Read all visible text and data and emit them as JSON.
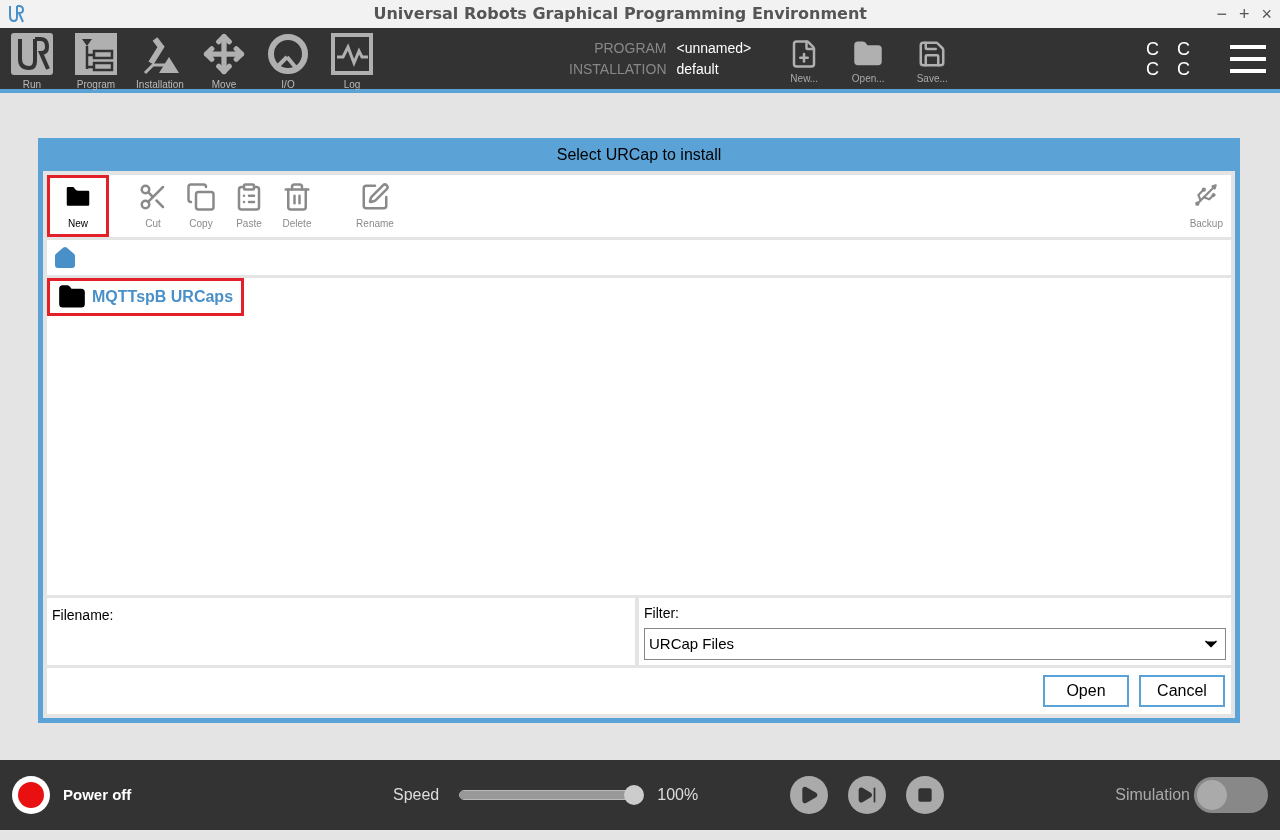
{
  "window": {
    "title": "Universal Robots Graphical Programming Environment",
    "controls": [
      "−",
      "+",
      "×"
    ]
  },
  "nav": [
    {
      "label": "Run",
      "kind": "run"
    },
    {
      "label": "Program",
      "kind": "program"
    },
    {
      "label": "Installation",
      "kind": "installation"
    },
    {
      "label": "Move",
      "kind": "move"
    },
    {
      "label": "I/O",
      "kind": "io"
    },
    {
      "label": "Log",
      "kind": "log"
    }
  ],
  "program_info": [
    {
      "label": "PROGRAM",
      "value": "<unnamed>"
    },
    {
      "label": "INSTALLATION",
      "value": "default"
    }
  ],
  "file_actions": [
    {
      "label": "New...",
      "kind": "new"
    },
    {
      "label": "Open...",
      "kind": "open"
    },
    {
      "label": "Save...",
      "kind": "save"
    }
  ],
  "status_letters": [
    "C",
    "C",
    "C",
    "C"
  ],
  "dialog": {
    "title": "Select URCap to install",
    "toolbar": [
      {
        "label": "New",
        "kind": "new",
        "disabled": false,
        "highlighted": true
      },
      {
        "label": "Cut",
        "kind": "cut",
        "disabled": true,
        "highlighted": false
      },
      {
        "label": "Copy",
        "kind": "copy",
        "disabled": true,
        "highlighted": false
      },
      {
        "label": "Paste",
        "kind": "paste",
        "disabled": true,
        "highlighted": false
      },
      {
        "label": "Delete",
        "kind": "delete",
        "disabled": true,
        "highlighted": false
      },
      {
        "label": "Rename",
        "kind": "rename",
        "disabled": true,
        "highlighted": false
      }
    ],
    "backup": {
      "label": "Backup"
    },
    "files": [
      {
        "name": "MQTTspB URCaps",
        "highlighted": true
      }
    ],
    "filename": {
      "label": "Filename:"
    },
    "filter": {
      "label": "Filter:",
      "value": "URCap Files"
    },
    "buttons": [
      "Open",
      "Cancel"
    ]
  },
  "footer": {
    "power": "Power off",
    "speed_label": "Speed",
    "speed": {
      "level": 1.0
    },
    "speed_reading": "100%",
    "simulation": {
      "label": "Simulation",
      "on": false
    }
  }
}
